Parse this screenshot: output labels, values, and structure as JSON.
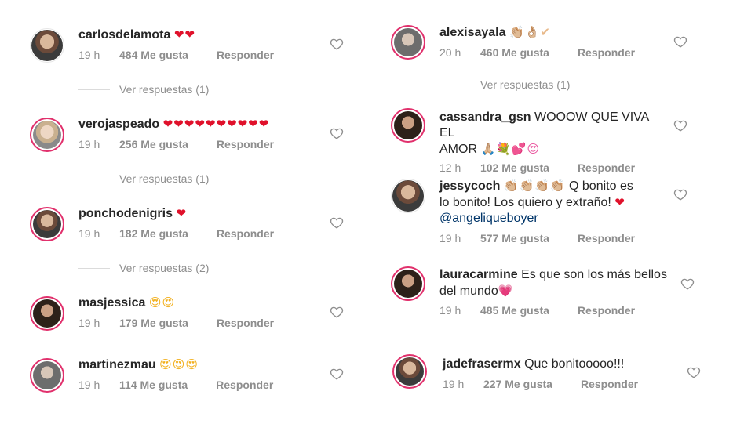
{
  "like_label": "Me gusta",
  "reply_label": "Responder",
  "left": {
    "comments": [
      {
        "user": "carlosdelamota",
        "emoji": "❤❤",
        "time": "19 h",
        "likes": "484 Me gusta",
        "reply": "Responder",
        "view_replies": "Ver respuestas (1)"
      },
      {
        "user": "verojaspeado",
        "emoji": "❤❤❤❤❤❤❤❤❤❤",
        "time": "19 h",
        "likes": "256 Me gusta",
        "reply": "Responder",
        "view_replies": "Ver respuestas (1)"
      },
      {
        "user": "ponchodenigris",
        "emoji": "❤",
        "time": "19 h",
        "likes": "182 Me gusta",
        "reply": "Responder",
        "view_replies": "Ver respuestas (2)"
      },
      {
        "user": "masjessica",
        "emoji": "😍😍",
        "time": "19 h",
        "likes": "179 Me gusta",
        "reply": "Responder"
      },
      {
        "user": "martinezmau",
        "emoji": "😍😍😍",
        "time": "19 h",
        "likes": "114 Me gusta",
        "reply": "Responder"
      }
    ]
  },
  "right": {
    "comments": [
      {
        "user": "alexisayala",
        "emoji": "👏🏼👌🏼✔",
        "time": "20 h",
        "likes": "460 Me gusta",
        "reply": "Responder",
        "view_replies": "Ver respuestas (1)"
      },
      {
        "user": "cassandra_gsn",
        "text": "WOOOW QUE VIVA EL",
        "text2": "AMOR",
        "emoji2": "🙏🏼💐💕😍",
        "time": "12 h",
        "likes": "102 Me gusta",
        "reply": "Responder"
      },
      {
        "user": "jessycoch",
        "emoji": "👏🏼👏🏼👏🏼👏🏼",
        "text": "Q bonito es",
        "text2": "lo bonito! Los quiero y extraño!",
        "emoji2": "❤",
        "mention": "@angeliqueboyer",
        "time": "19 h",
        "likes": "577 Me gusta",
        "reply": "Responder"
      },
      {
        "user": "lauracarmine",
        "text": "Es que son los más bellos",
        "text2": "del mundo",
        "emoji2": "💗",
        "time": "19 h",
        "likes": "485 Me gusta",
        "reply": "Responder"
      },
      {
        "user": "jadefrasermx",
        "text": "Que bonitooooo!!!",
        "time": "19 h",
        "likes": "227 Me gusta",
        "reply": "Responder"
      }
    ]
  }
}
